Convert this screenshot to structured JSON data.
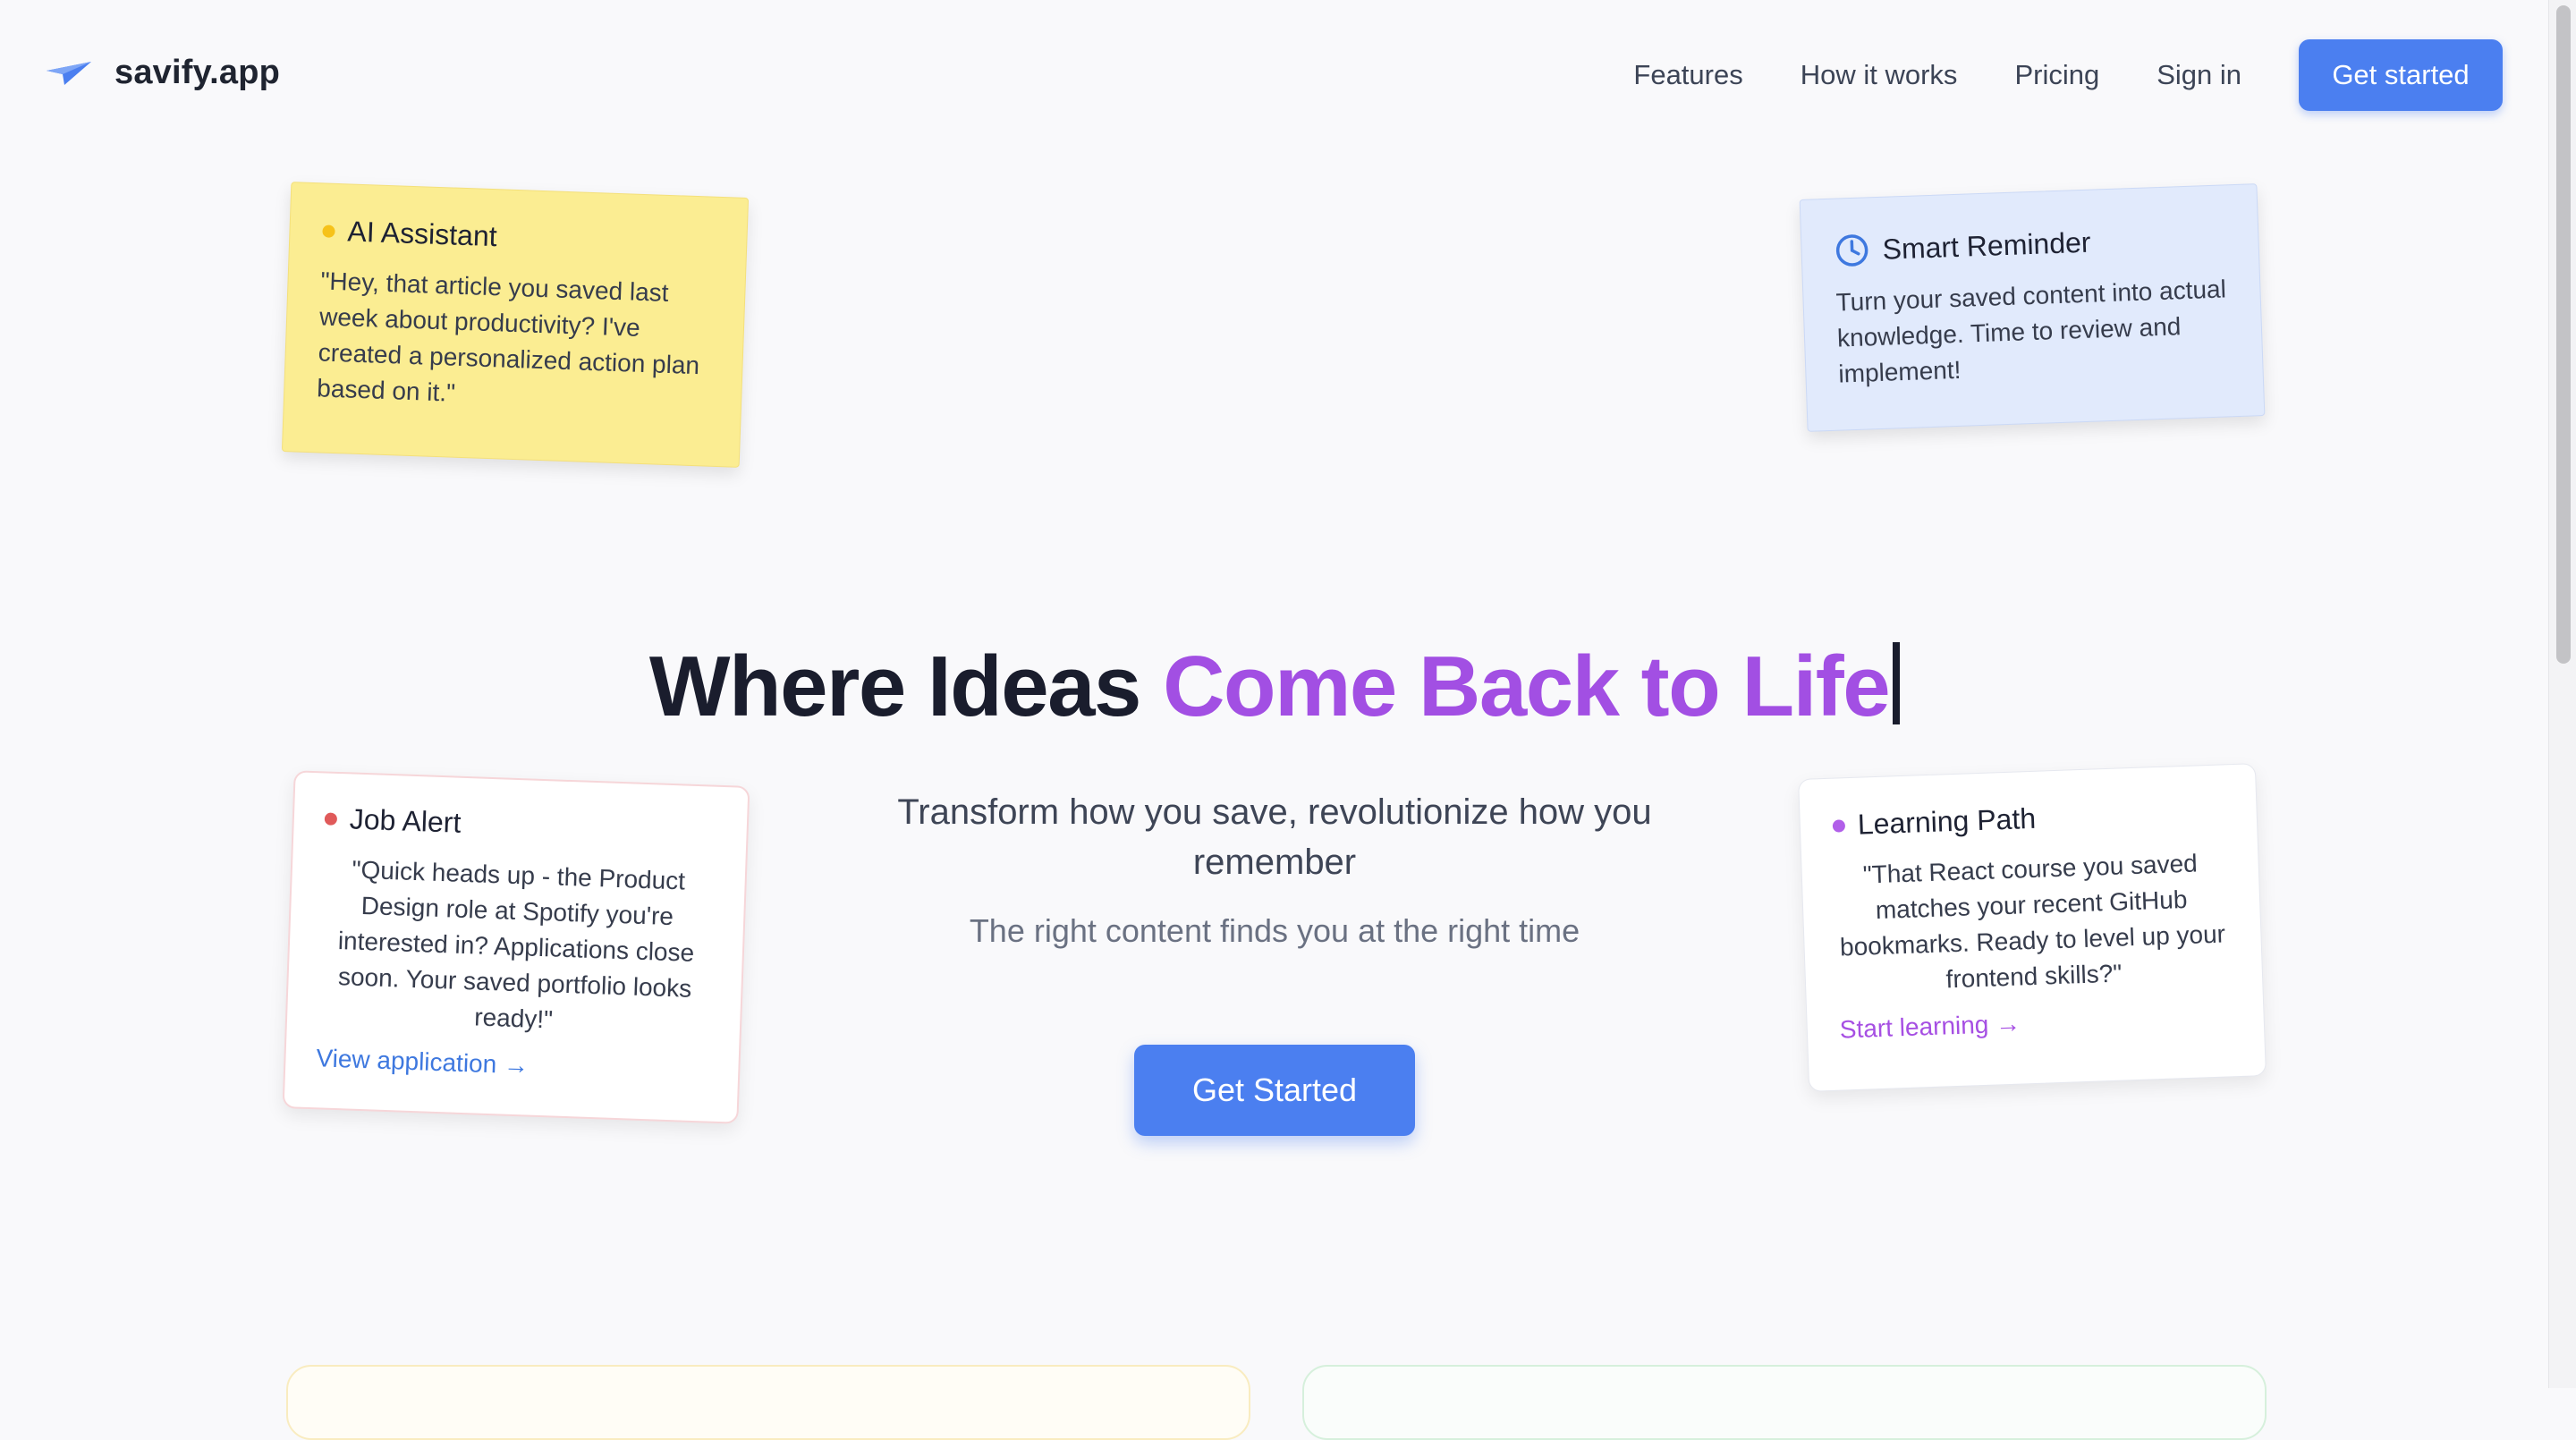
{
  "header": {
    "logo_icon": "paper-plane-icon",
    "brand": "savify.app",
    "nav": [
      "Features",
      "How it works",
      "Pricing",
      "Sign in"
    ],
    "cta": "Get started"
  },
  "cards": {
    "ai": {
      "title": "AI Assistant",
      "body": "\"Hey, that article you saved last week about productivity? I've created a personalized action plan based on it.\"",
      "dot_color": "#f6c21a"
    },
    "smart": {
      "icon": "clock-icon",
      "title": "Smart Reminder",
      "body": "Turn your saved content into actual knowledge. Time to review and implement!"
    },
    "job": {
      "title": "Job Alert",
      "body": "\"Quick heads up - the Product Design role at Spotify you're interested in? Applications close soon. Your saved portfolio looks ready!\"",
      "link": "View application →",
      "dot_color": "#e05a5a"
    },
    "learn": {
      "title": "Learning Path",
      "body": "\"That React course you saved matches your recent GitHub bookmarks. Ready to level up your frontend skills?\"",
      "link": "Start learning →",
      "dot_color": "#b15fe9"
    }
  },
  "hero": {
    "title_plain": "Where Ideas ",
    "title_accent": "Come Back to Life",
    "subtitle": "Transform how you save, revolutionize how you remember",
    "tagline": "The right content finds you at the right time",
    "cta": "Get Started"
  },
  "colors": {
    "primary": "#4b7ff0",
    "accent": "#a24fe3",
    "ai_card": "#fbed92",
    "smart_card": "#e1eafc"
  }
}
